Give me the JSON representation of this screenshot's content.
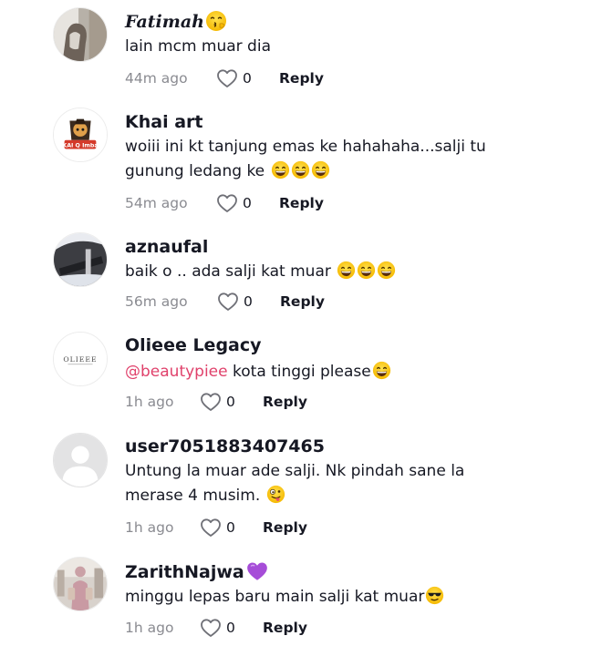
{
  "comments": [
    {
      "username": "Fatimah",
      "text": "lain mcm muar dia",
      "time": "44m ago",
      "likes": "0",
      "reply_label": "Reply",
      "name_emoji": "thinking-kiss-emoji-icon"
    },
    {
      "username": "Khai art",
      "text_line1": "woiii ini kt tanjung emas ke hahahaha...salji tu",
      "text_line2": "gunung ledang ke",
      "time": "54m ago",
      "likes": "0",
      "reply_label": "Reply",
      "avatar_text": "KAI Q Imba",
      "text_emojis": [
        "grinning-sweat-emoji-icon",
        "grinning-sweat-emoji-icon",
        "grinning-sweat-emoji-icon"
      ]
    },
    {
      "username": "aznaufal",
      "text": "baik o .. ada salji kat muar",
      "time": "56m ago",
      "likes": "0",
      "reply_label": "Reply",
      "text_emojis": [
        "grinning-sweat-emoji-icon",
        "grinning-sweat-emoji-icon",
        "grinning-sweat-emoji-icon"
      ]
    },
    {
      "username": "Olieee Legacy",
      "mention": "@beautypiee",
      "text": " kota tinggi please",
      "time": "1h ago",
      "likes": "0",
      "reply_label": "Reply",
      "avatar_text": "OLIEEE",
      "text_emojis": [
        "grinning-sweat-emoji-icon"
      ]
    },
    {
      "username": "user7051883407465",
      "text_line1": "Untung la muar ade salji. Nk pindah sane la",
      "text_line2": "merase 4 musim.",
      "time": "1h ago",
      "likes": "0",
      "reply_label": "Reply",
      "text_emojis": [
        "zany-face-emoji-icon"
      ]
    },
    {
      "username": "ZarithNajwa",
      "text": "minggu lepas baru main salji kat muar",
      "time": "1h ago",
      "likes": "0",
      "reply_label": "Reply",
      "name_emoji": "purple-heart-emoji-icon",
      "text_emojis": [
        "sunglasses-face-emoji-icon"
      ]
    }
  ],
  "colors": {
    "text": "#161823",
    "muted": "#8a8b91",
    "mention": "#e0416b",
    "heart_outline": "#8a8b91"
  }
}
